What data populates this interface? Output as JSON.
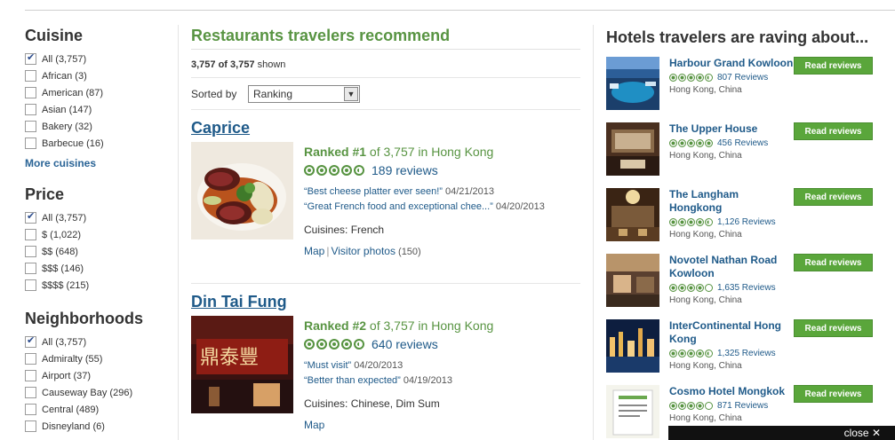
{
  "filters": {
    "cuisine": {
      "title": "Cuisine",
      "items": [
        {
          "label": "All (3,757)",
          "checked": true
        },
        {
          "label": "African (3)",
          "checked": false
        },
        {
          "label": "American (87)",
          "checked": false
        },
        {
          "label": "Asian (147)",
          "checked": false
        },
        {
          "label": "Bakery (32)",
          "checked": false
        },
        {
          "label": "Barbecue (16)",
          "checked": false
        }
      ],
      "more": "More cuisines"
    },
    "price": {
      "title": "Price",
      "items": [
        {
          "label": "All (3,757)",
          "checked": true
        },
        {
          "label": "$ (1,022)",
          "checked": false
        },
        {
          "label": "$$ (648)",
          "checked": false
        },
        {
          "label": "$$$ (146)",
          "checked": false
        },
        {
          "label": "$$$$ (215)",
          "checked": false
        }
      ]
    },
    "neighborhoods": {
      "title": "Neighborhoods",
      "items": [
        {
          "label": "All (3,757)",
          "checked": true
        },
        {
          "label": "Admiralty (55)",
          "checked": false
        },
        {
          "label": "Airport (37)",
          "checked": false
        },
        {
          "label": "Causeway Bay (296)",
          "checked": false
        },
        {
          "label": "Central (489)",
          "checked": false
        },
        {
          "label": "Disneyland (6)",
          "checked": false
        }
      ]
    }
  },
  "main": {
    "title": "Restaurants travelers recommend",
    "shown_count": "3,757 of 3,757",
    "shown_suffix": " shown",
    "sort_label": "Sorted by",
    "sort_value": "Ranking",
    "restaurants": [
      {
        "name": "Caprice",
        "rank_prefix": "Ranked #1",
        "rank_suffix": " of 3,757 in Hong Kong",
        "rating": 4.5,
        "reviews": "189 reviews",
        "quotes": [
          {
            "text": "“Best cheese platter ever seen!”",
            "date": " 04/21/2013"
          },
          {
            "text": "“Great French food and exceptional chee...”",
            "date": " 04/20/2013"
          }
        ],
        "cuisines_label": "Cuisines: ",
        "cuisines": "French",
        "map": "Map",
        "photos": "Visitor photos",
        "photos_count": " (150)"
      },
      {
        "name": "Din Tai Fung",
        "rank_prefix": "Ranked #2",
        "rank_suffix": " of 3,757 in Hong Kong",
        "rating": 4.5,
        "reviews": "640 reviews",
        "quotes": [
          {
            "text": "“Must visit”",
            "date": " 04/20/2013"
          },
          {
            "text": "“Better than expected”",
            "date": " 04/19/2013"
          }
        ],
        "cuisines_label": "Cuisines: ",
        "cuisines": "Chinese, Dim Sum",
        "map": "Map"
      }
    ]
  },
  "hotels": {
    "title": "Hotels travelers are raving about...",
    "button_label": "Read reviews",
    "items": [
      {
        "name": "Harbour Grand Kowloon",
        "rating": 4.5,
        "reviews": "807 Reviews",
        "location": "Hong Kong, China"
      },
      {
        "name": "The Upper House",
        "rating": 5,
        "reviews": "456 Reviews",
        "location": "Hong Kong, China"
      },
      {
        "name": "The Langham Hongkong",
        "rating": 4.5,
        "reviews": "1,126 Reviews",
        "location": "Hong Kong, China"
      },
      {
        "name": "Novotel Nathan Road Kowloon",
        "rating": 4,
        "reviews": "1,635 Reviews",
        "location": "Hong Kong, China"
      },
      {
        "name": "InterContinental Hong Kong",
        "rating": 4.5,
        "reviews": "1,325 Reviews",
        "location": "Hong Kong, China"
      },
      {
        "name": "Cosmo Hotel Mongkok",
        "rating": 4,
        "reviews": "871 Reviews",
        "location": "Hong Kong, China"
      }
    ]
  },
  "overlay": {
    "close_label": "close ✕"
  }
}
